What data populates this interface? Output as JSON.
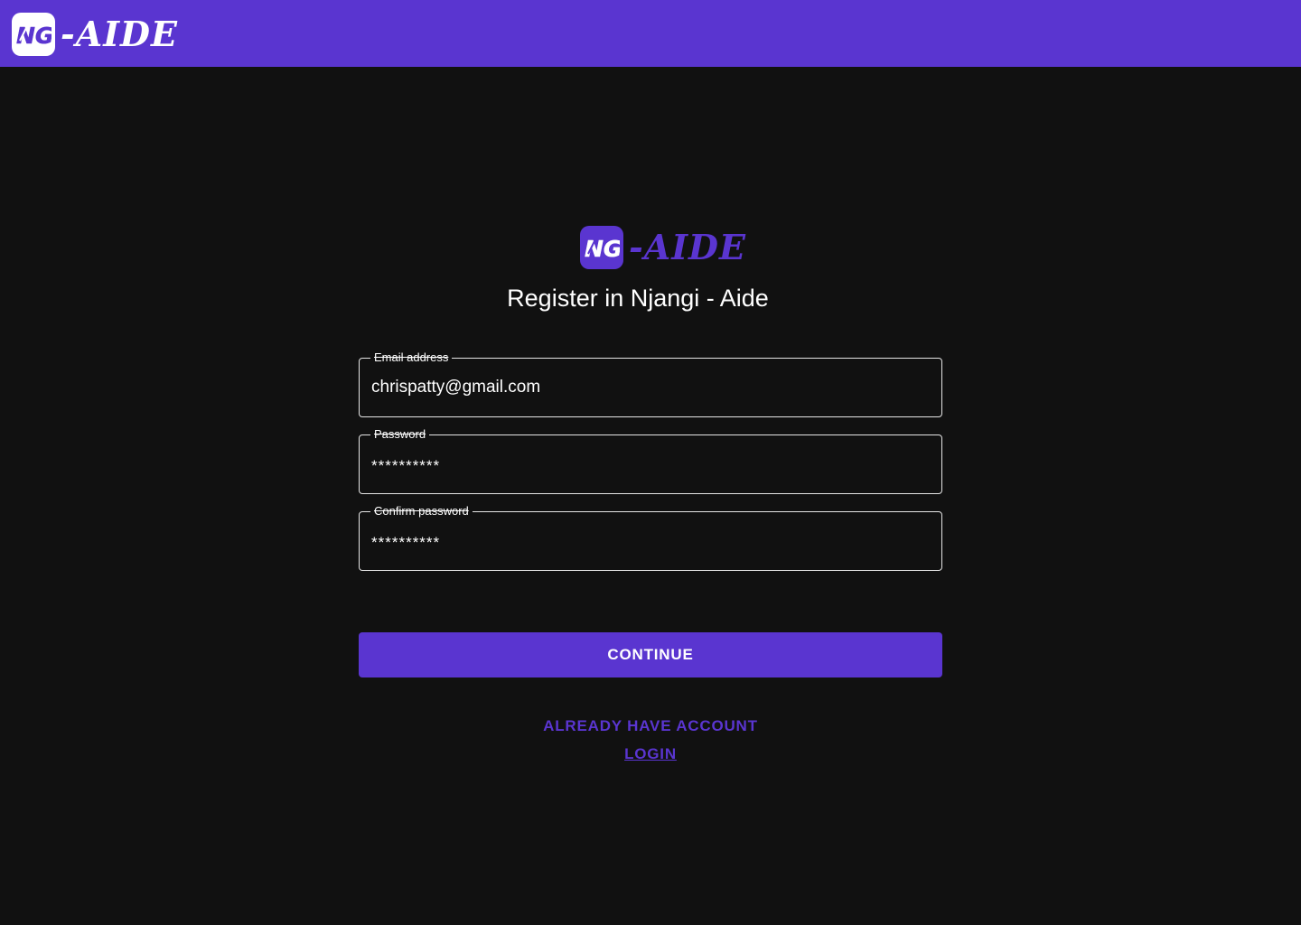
{
  "header": {
    "logo_word": "-AIDE"
  },
  "brand": {
    "logo_word": "-AIDE"
  },
  "page": {
    "title": "Register in Njangi - Aide"
  },
  "form": {
    "email": {
      "label": "Email address",
      "value": "chrispatty@gmail.com"
    },
    "password": {
      "label": "Password",
      "value": "**********"
    },
    "confirm_password": {
      "label": "Confirm password",
      "value": "**********"
    },
    "continue_label": "CONTINUE"
  },
  "footer": {
    "account_text": "ALREADY HAVE ACCOUNT",
    "login_label": "LOGIN"
  },
  "colors": {
    "accent": "#5a35d0",
    "background": "#111111",
    "text": "#ffffff"
  },
  "icons": {
    "logo": "ng-logo-icon"
  }
}
